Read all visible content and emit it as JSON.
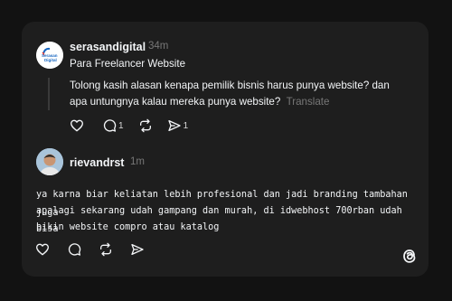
{
  "post": {
    "username": "serasandigital",
    "time": "34m",
    "title": "Para Freelancer Website",
    "body_line1": "Tolong kasih alasan kenapa pemilik bisnis harus punya website? dan",
    "body_line2": "apa untungnya kalau mereka punya website?",
    "translate_label": "Translate",
    "avatar_label_line1": "Serasan",
    "avatar_label_line2": "Digital",
    "actions": {
      "like_icon": "heart-icon",
      "reply_icon": "speech-bubble-icon",
      "reply_count": "1",
      "repost_icon": "repost-icon",
      "share_icon": "send-icon",
      "share_count": "1"
    }
  },
  "reply": {
    "username": "rievandrst",
    "time": "1m",
    "line1": "ya karna biar keliatan lebih profesional dan jadi branding tambahan juga",
    "line2": "apalagi sekarang udah gampang dan murah, di idwebhost 700rban udah bisa",
    "line3": "bikin website compro atau katalog",
    "actions": {
      "like_icon": "heart-icon",
      "reply_icon": "speech-bubble-icon",
      "repost_icon": "repost-icon",
      "share_icon": "send-icon"
    }
  },
  "footer": {
    "logo_icon": "threads-logo-icon"
  },
  "colors": {
    "background": "#121212",
    "card": "#1e1e1e",
    "text": "#f3f5f7",
    "muted": "#777777",
    "brand_blue": "#1565c0"
  }
}
